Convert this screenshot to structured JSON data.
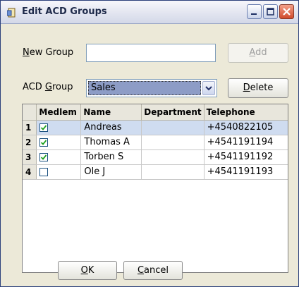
{
  "window": {
    "title": "Edit ACD Groups"
  },
  "new_group": {
    "label_u": "N",
    "label_rest": "ew Group",
    "value": "",
    "add_label_u": "A",
    "add_label_rest": "dd"
  },
  "acd_group": {
    "label_pre": "ACD ",
    "label_u": "G",
    "label_rest": "roup",
    "selected": "Sales",
    "delete_label_u": "D",
    "delete_label_rest": "elete"
  },
  "grid": {
    "columns": [
      "Medlem",
      "Name",
      "Department",
      "Telephone"
    ],
    "rows": [
      {
        "num": "1",
        "member": true,
        "name": "Andreas",
        "department": "",
        "telephone": "+4540822105",
        "selected": true
      },
      {
        "num": "2",
        "member": true,
        "name": "Thomas A",
        "department": "",
        "telephone": "+4541191194",
        "selected": false
      },
      {
        "num": "3",
        "member": true,
        "name": "Torben S",
        "department": "",
        "telephone": "+4541191192",
        "selected": false
      },
      {
        "num": "4",
        "member": false,
        "name": "Ole J",
        "department": "",
        "telephone": "+4541191193",
        "selected": false
      }
    ]
  },
  "footer": {
    "ok_u": "O",
    "ok_rest": "K",
    "cancel_u": "C",
    "cancel_rest": "ancel"
  },
  "colors": {
    "selection": "#cfdcf0",
    "combo_highlight": "#8d9cc6",
    "window_bg": "#ece9d8"
  }
}
